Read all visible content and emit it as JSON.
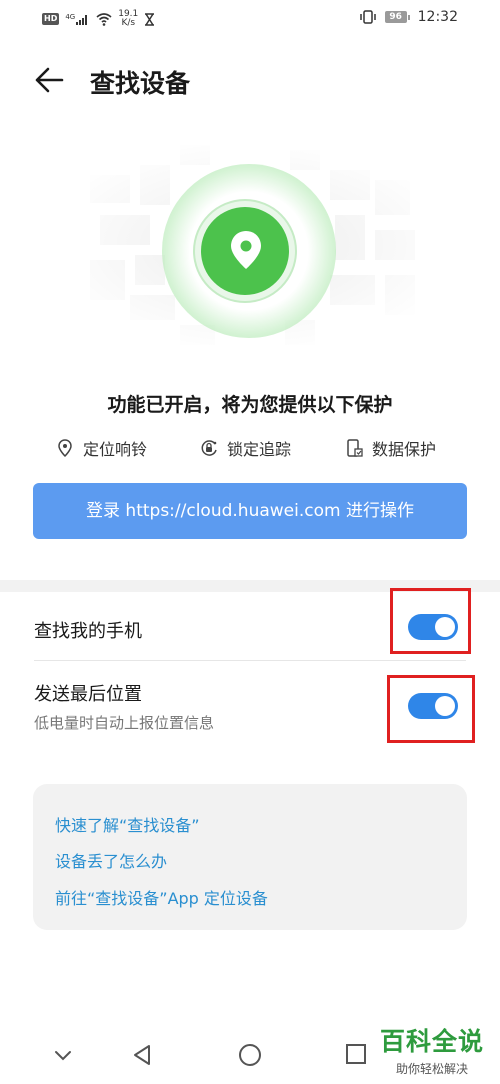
{
  "status_bar": {
    "hd": "HD",
    "signal_type": "4G",
    "net_speed_value": "19.1",
    "net_speed_unit": "K/s",
    "battery": "96",
    "time": "12:32"
  },
  "header": {
    "title": "查找设备"
  },
  "status_text": "功能已开启，将为您提供以下保护",
  "features": [
    {
      "label": "定位响铃",
      "icon": "location-pin-icon"
    },
    {
      "label": "锁定追踪",
      "icon": "lock-track-icon"
    },
    {
      "label": "数据保护",
      "icon": "phone-data-icon"
    }
  ],
  "login_button": {
    "label": "登录 https://cloud.huawei.com 进行操作"
  },
  "settings": [
    {
      "title": "查找我的手机",
      "toggle_on": true
    },
    {
      "title": "发送最后位置",
      "subtitle": "低电量时自动上报位置信息",
      "toggle_on": true
    }
  ],
  "help_links": [
    "快速了解“查找设备”",
    "设备丢了怎么办",
    "前往“查找设备”App 定位设备"
  ],
  "watermark": {
    "title": "百科全说",
    "subtitle": "助你轻松解决"
  },
  "colors": {
    "accent_blue": "#5c9bf0",
    "toggle_blue": "#2f86e8",
    "link_blue": "#2a8fd0",
    "pin_green": "#4cc24c",
    "highlight_red": "#e02020"
  }
}
